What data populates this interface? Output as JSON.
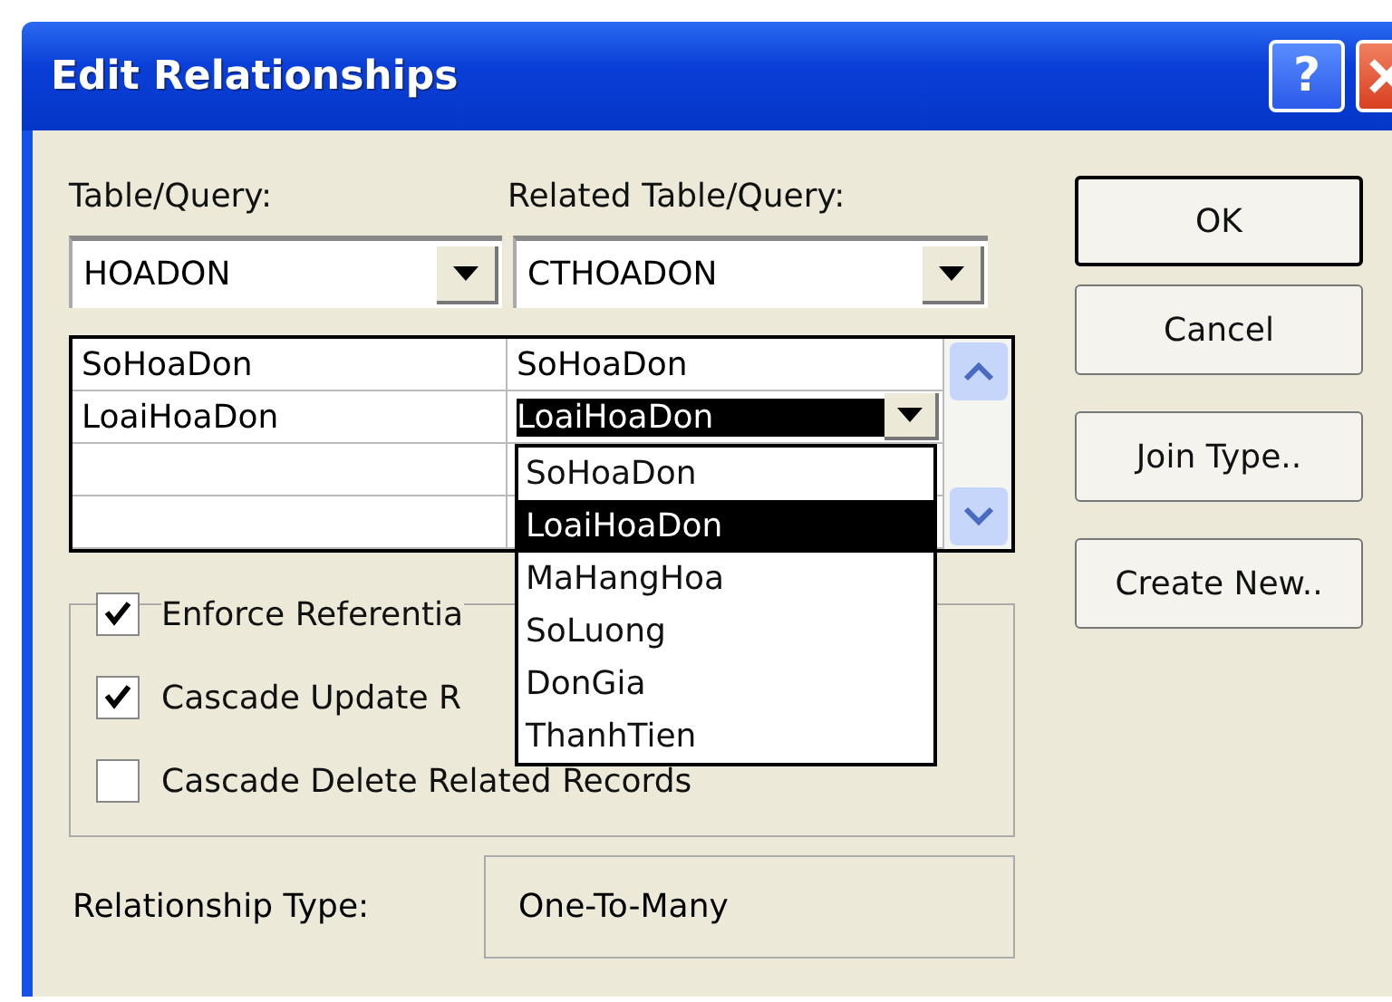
{
  "window": {
    "title": "Edit Relationships",
    "help": "?"
  },
  "table_query": {
    "label": "Table/Query:",
    "value": "HOADON"
  },
  "related_table_query": {
    "label": "Related Table/Query:",
    "value": "CTHOADON"
  },
  "fields_grid": {
    "rows": [
      {
        "left": "SoHoaDon",
        "right": "SoHoaDon",
        "editing": false
      },
      {
        "left": "LoaiHoaDon",
        "right": "LoaiHoaDon",
        "editing": true
      }
    ]
  },
  "dropdown": {
    "options": [
      {
        "label": "SoHoaDon",
        "selected": false
      },
      {
        "label": "LoaiHoaDon",
        "selected": true
      },
      {
        "label": "MaHangHoa",
        "selected": false
      },
      {
        "label": "SoLuong",
        "selected": false
      },
      {
        "label": "DonGia",
        "selected": false
      },
      {
        "label": "ThanhTien",
        "selected": false
      }
    ]
  },
  "options": [
    {
      "label": "Enforce Referentia",
      "checked": true
    },
    {
      "label": "Cascade Update R",
      "checked": true
    },
    {
      "label": "Cascade Delete Related Records",
      "checked": false
    }
  ],
  "relationship_type": {
    "label": "Relationship Type:",
    "value": "One-To-Many"
  },
  "buttons": [
    {
      "label": "OK",
      "default": true
    },
    {
      "label": "Cancel",
      "default": false
    },
    {
      "label": "Join Type..",
      "default": false
    },
    {
      "label": "Create New..",
      "default": false
    }
  ]
}
